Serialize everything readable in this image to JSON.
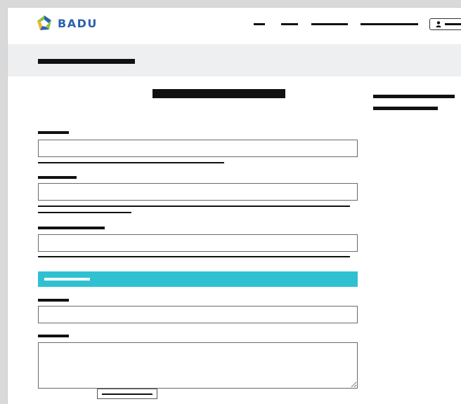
{
  "header": {
    "brand": "BADU",
    "nav_items": [
      "nav-1",
      "nav-2",
      "nav-3",
      "nav-4"
    ],
    "account_icon": "user-icon"
  },
  "colors": {
    "brand_blue": "#2c62ad",
    "brand_green": "#8cc63f",
    "brand_yellow": "#f2b233",
    "section_accent": "#2fc1d1",
    "band_bg": "#eeeff1"
  },
  "form": {
    "fields": [
      {
        "value": ""
      },
      {
        "value": ""
      },
      {
        "value": ""
      },
      {
        "value": ""
      }
    ],
    "message": {
      "value": ""
    }
  }
}
